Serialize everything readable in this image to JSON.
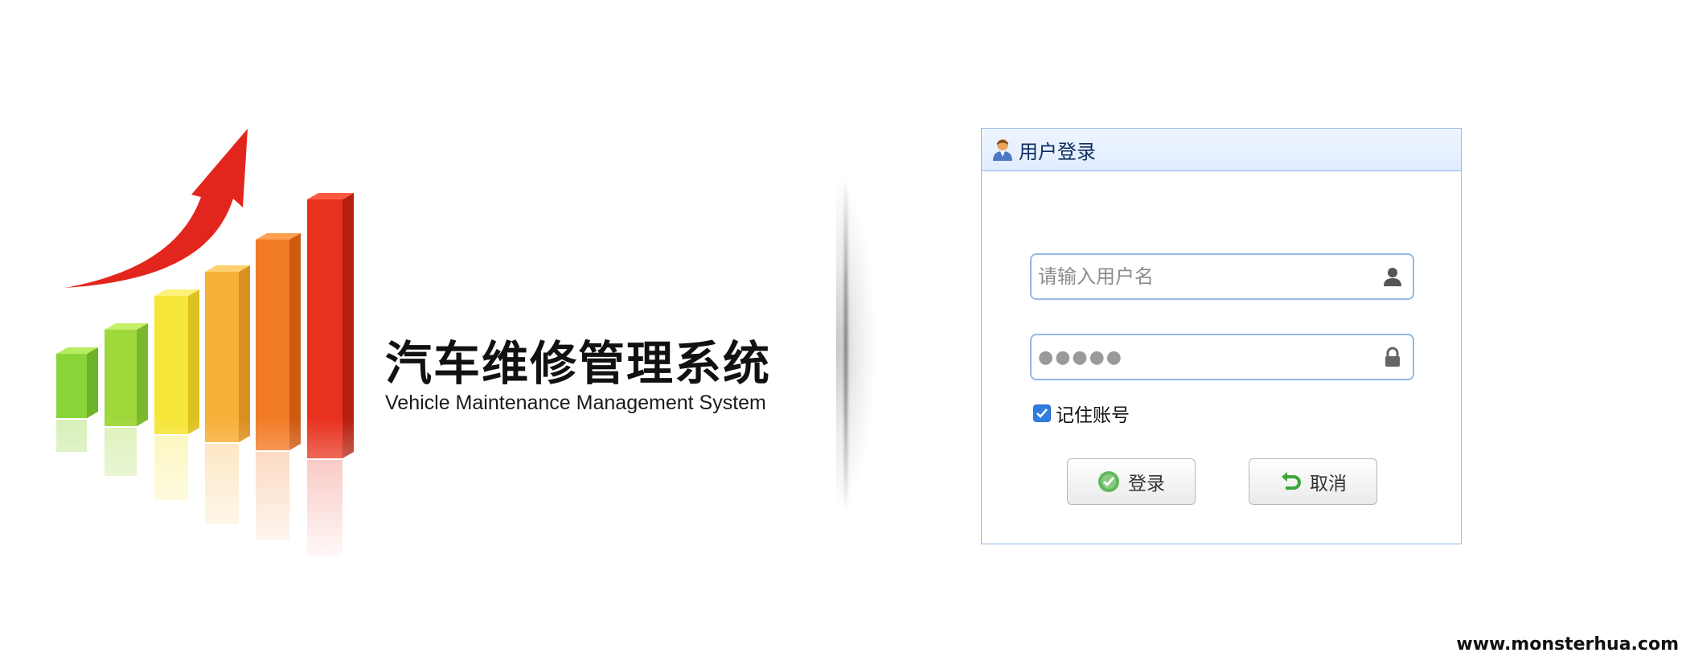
{
  "brand": {
    "title": "汽车维修管理系统",
    "subtitle": "Vehicle Maintenance Management System"
  },
  "login_panel": {
    "title": "用户登录",
    "username": {
      "placeholder": "请输入用户名",
      "value": "",
      "icon": "user-silhouette-icon"
    },
    "password": {
      "masked_value": "●●●●●",
      "icon": "lock-icon"
    },
    "remember": {
      "label": "记住账号",
      "checked": true
    },
    "buttons": {
      "login_label": "登录",
      "cancel_label": "取消"
    }
  },
  "colors": {
    "panel_border": "#95b8e7",
    "panel_header_bg": "#e0ecff",
    "checkbox_blue": "#2f7de1",
    "login_icon_green": "#5fb85b",
    "cancel_icon_green": "#3da63a"
  },
  "watermark": "www.monsterhua.com"
}
